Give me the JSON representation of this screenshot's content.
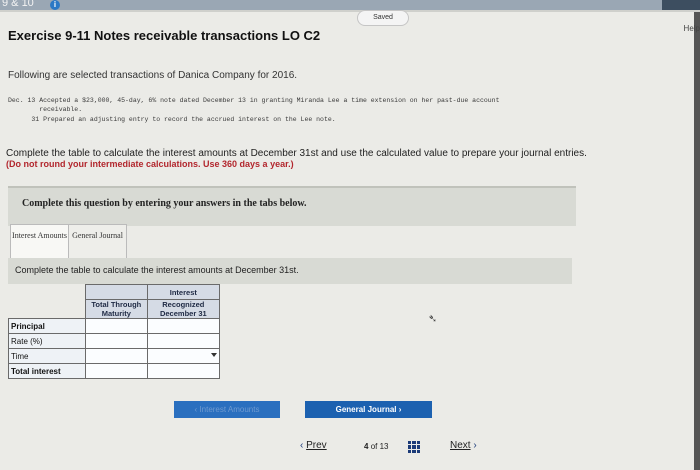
{
  "topbar": {
    "crumb": "9 & 10",
    "info_label": "i"
  },
  "status": {
    "saved": "Saved",
    "help": "Help"
  },
  "exercise": {
    "title": "Exercise 9-11 Notes receivable transactions LO C2",
    "intro": "Following are selected transactions of Danica Company for 2016.",
    "transactions": [
      "Dec. 13 Accepted a $23,000, 45-day, 6% note dated December 13 in granting Miranda Lee a time extension on her past-due account",
      "        receivable.",
      "      31 Prepared an adjusting entry to record the accrued interest on the Lee note."
    ],
    "instruction": "Complete the table to calculate the interest amounts at December 31st and use the calculated value to prepare your journal entries.",
    "note": "(Do not round your intermediate calculations. Use 360 days a year.)"
  },
  "panel": {
    "text": "Complete this question by entering your answers in the tabs below."
  },
  "tabs": [
    {
      "label": "Interest Amounts",
      "active": true
    },
    {
      "label": "General Journal",
      "active": false
    }
  ],
  "subhead": "Complete the table to calculate the interest amounts at December 31st.",
  "table": {
    "col1": "Total Through Maturity",
    "col2_top": "Interest",
    "col2": "Recognized December 31",
    "rows": [
      "Principal",
      "Rate (%)",
      "Time",
      "Total interest"
    ]
  },
  "buttons": {
    "prev_tab": "Interest Amounts",
    "next_tab": "General Journal"
  },
  "pager": {
    "prev": "Prev",
    "page": "4",
    "of": "of",
    "total": "13",
    "next": "Next"
  }
}
